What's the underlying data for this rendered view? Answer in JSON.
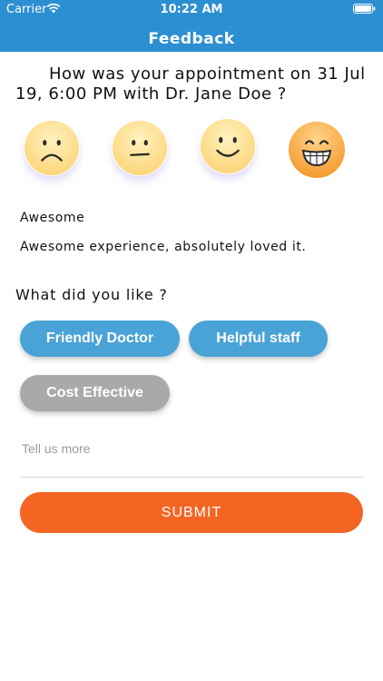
{
  "status_bar": {
    "carrier": "Carrier",
    "time": "10:22 AM"
  },
  "nav": {
    "title": "Feedback"
  },
  "question": "How was your appointment on 31 Jul 19, 6:00 PM with Dr. Jane Doe ?",
  "ratings": [
    {
      "face": "sad",
      "icon": "sad-face-icon",
      "selected": false
    },
    {
      "face": "neutral",
      "icon": "neutral-face-icon",
      "selected": false
    },
    {
      "face": "smile",
      "icon": "smile-face-icon",
      "selected": false
    },
    {
      "face": "grin",
      "icon": "grin-face-icon",
      "selected": true
    }
  ],
  "selected_rating": {
    "label": "Awesome",
    "description": "Awesome experience, absolutely loved it."
  },
  "likes": {
    "heading": "What did you like ?",
    "options": [
      {
        "label": "Friendly Doctor",
        "selected": true
      },
      {
        "label": "Helpful staff",
        "selected": true
      },
      {
        "label": "Cost Effective",
        "selected": false
      }
    ]
  },
  "more_input": {
    "placeholder": "Tell us more",
    "value": ""
  },
  "submit": {
    "label": "SUBMIT"
  },
  "colors": {
    "header": "#2b8fd2",
    "chip_selected": "#4aa3d6",
    "chip_unselected": "#a9a9a9",
    "submit": "#f46524",
    "emoji_active": "#f7a23a",
    "emoji_inactive": "#fde08a"
  }
}
